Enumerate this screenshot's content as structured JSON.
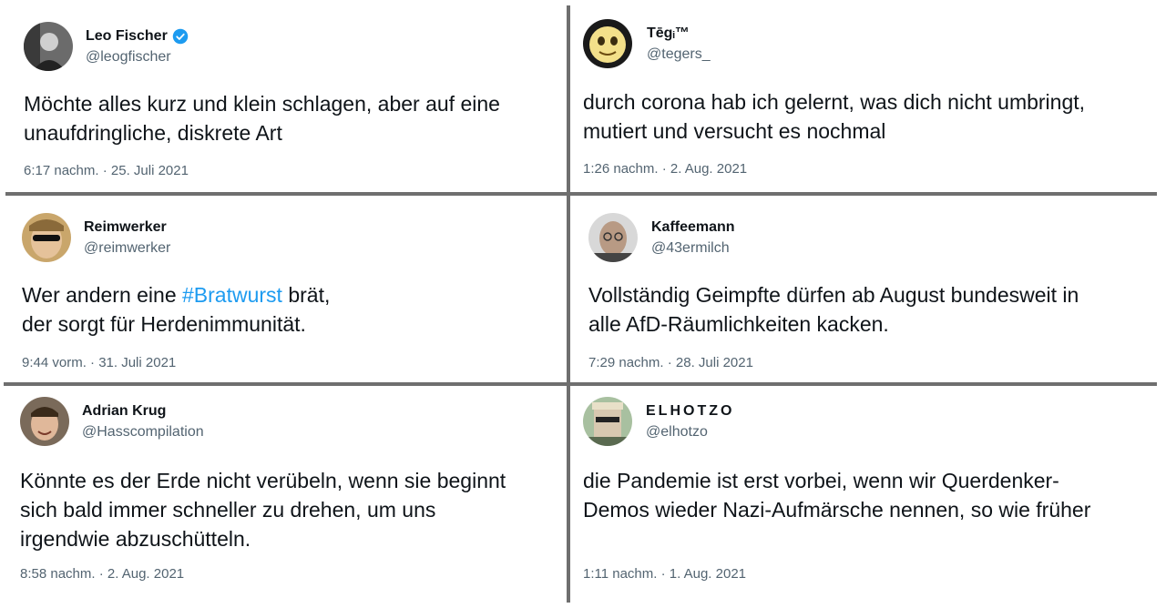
{
  "tweets": [
    {
      "name": "Leo Fischer",
      "verified": true,
      "handle": "@leogfischer",
      "lines": [
        "Möchte alles kurz und klein schlagen, aber auf eine",
        "unaufdringliche, diskrete Art"
      ],
      "time": "6:17 nachm. · 25. Juli 2021",
      "avatar_icon": "portrait-dark-photo"
    },
    {
      "name": "Tēgᵢ™",
      "verified": false,
      "handle": "@tegers_",
      "lines": [
        "durch corona hab ich gelernt, was dich nicht umbringt,",
        "mutiert und versucht es nochmal"
      ],
      "time": "1:26 nachm. · 2. Aug. 2021",
      "avatar_icon": "yellow-cartoon-face"
    },
    {
      "name": "Reimwerker",
      "verified": false,
      "handle": "@reimwerker",
      "line1_prefix": "Wer andern eine ",
      "hashtag": "#Bratwurst",
      "line1_suffix": " brät,",
      "line2": "der sorgt für Herdenimmunität.",
      "time": "9:44 vorm. · 31. Juli 2021",
      "avatar_icon": "sunglasses-portrait"
    },
    {
      "name": "Kaffeemann",
      "verified": false,
      "handle": "@43ermilch",
      "lines": [
        "Vollständig Geimpfte dürfen ab August bundesweit in",
        "alle AfD-Räumlichkeiten kacken."
      ],
      "time": "7:29 nachm. · 28. Juli 2021",
      "avatar_icon": "glasses-portrait"
    },
    {
      "name": "Adrian Krug",
      "verified": false,
      "handle": "@Hasscompilation",
      "lines": [
        "Könnte es der Erde nicht verübeln, wenn sie beginnt",
        "sich bald immer schneller zu drehen, um uns",
        "irgendwie abzuschütteln."
      ],
      "time": "8:58 nachm. · 2. Aug. 2021",
      "avatar_icon": "smiling-portrait"
    },
    {
      "name": "ELHOTZO",
      "verified": false,
      "handle": "@elhotzo",
      "lines": [
        "die Pandemie ist erst vorbei, wenn wir Querdenker-",
        "Demos wieder Nazi-Aufmärsche nennen, so wie früher"
      ],
      "time": "1:11 nachm. · 1. Aug. 2021",
      "avatar_icon": "pixelated-sunglasses-portrait"
    }
  ],
  "colors": {
    "text": "#0f1419",
    "secondary": "#536471",
    "hashtag": "#1d9bf0",
    "verified": "#1d9bf0",
    "separator": "#6f6f6f"
  }
}
